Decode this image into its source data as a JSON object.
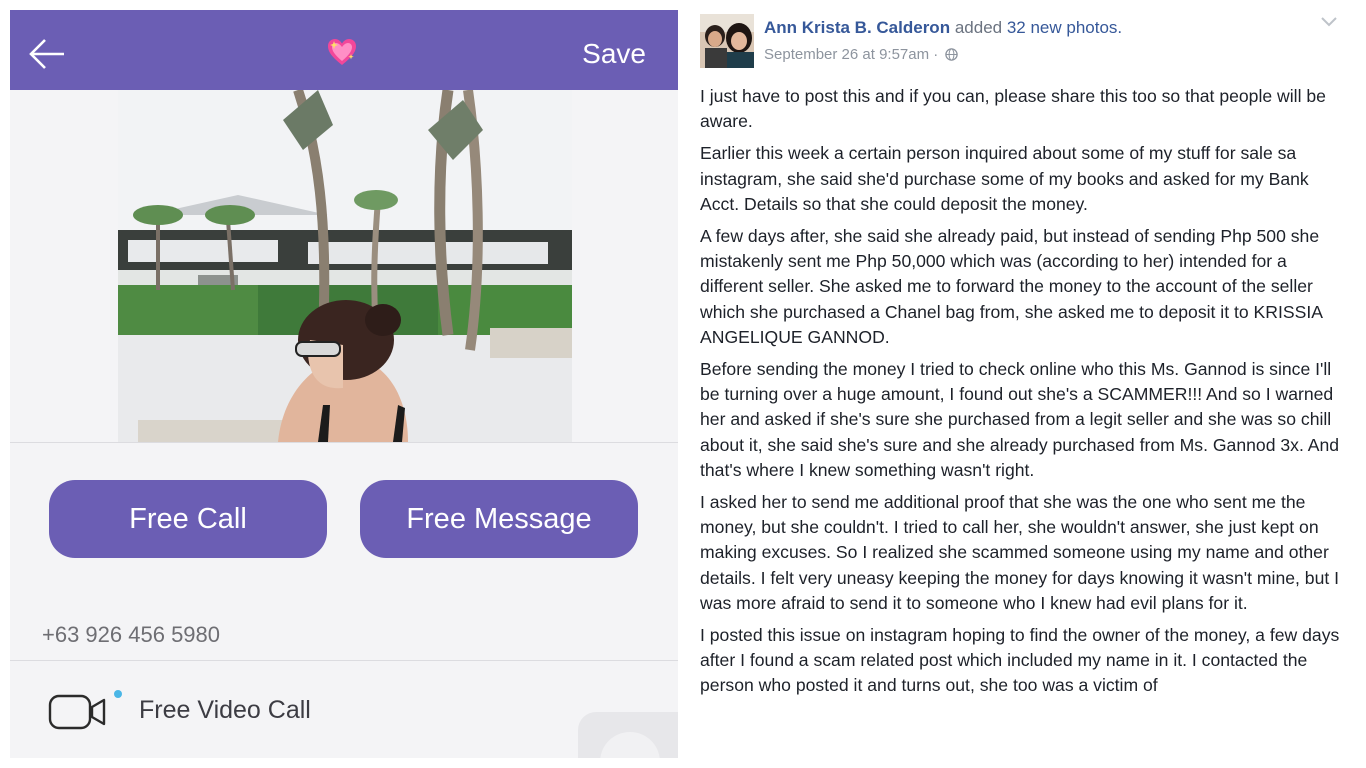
{
  "viber": {
    "header": {
      "back_icon": "arrow-left-icon",
      "center_icon": "sparkling-heart-icon",
      "save_label": "Save",
      "color": "#6b5eb4"
    },
    "buttons": {
      "free_call": "Free Call",
      "free_message": "Free Message"
    },
    "phone_number": "+63 926 456 5980",
    "video_call": {
      "icon": "video-camera-icon",
      "label": "Free Video Call"
    }
  },
  "facebook_post": {
    "author": "Ann Krista B. Calderon",
    "action_text": "added",
    "photos_link": "32 new photos.",
    "timestamp": "September 26 at 9:57am",
    "separator": " · ",
    "privacy_icon": "globe-icon",
    "menu_icon": "chevron-down-icon",
    "paragraphs": [
      "I just have to post this and if you can, please share this too so that people will be aware.",
      "Earlier this week a certain person inquired about some of my stuff for sale sa instagram, she said she'd purchase some of my books and asked for my Bank Acct. Details so that she could deposit the money.",
      "A few days after, she said she already paid, but instead of sending Php 500 she mistakenly sent me Php 50,000 which was (according to her) intended for a different seller. She asked me to forward the money to the account of the seller which she purchased a Chanel bag from, she asked me to deposit it to KRISSIA ANGELIQUE GANNOD.",
      "Before sending the money I tried to check online who this Ms. Gannod is since I'll be turning over a huge amount, I found out she's a SCAMMER!!! And so I warned her and asked if she's sure she purchased from a legit seller and she was so chill about it, she said she's sure and she already purchased from Ms. Gannod 3x. And that's where I knew something wasn't right.",
      "I asked her to send me additional proof that she was the one who sent me the money, but she couldn't. I tried to call her, she wouldn't answer, she just kept on making excuses. So I realized she scammed someone using my name and other details. I felt very uneasy keeping the money for days knowing it wasn't mine, but I was more afraid to send it to someone who I knew had evil plans for it.",
      "I posted this issue on instagram hoping to find the owner of the money, a few days after I found a scam related post which included my name in it. I contacted the person who posted it and turns out, she too was a victim of"
    ]
  }
}
